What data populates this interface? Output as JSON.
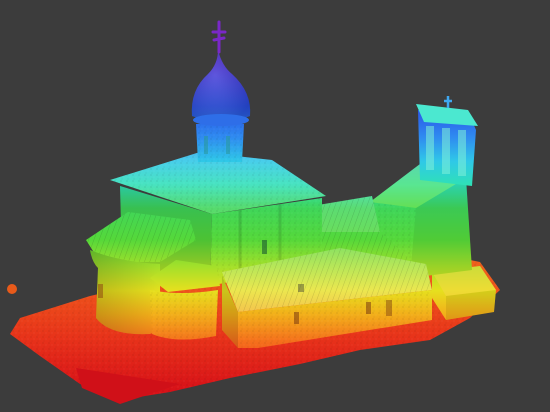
{
  "scene": {
    "subject": "point-cloud-church",
    "background_color": "#3c3c3c",
    "colormap": {
      "type": "elevation",
      "stops": [
        "#e8141a",
        "#f5701c",
        "#f2d21a",
        "#a5e02a",
        "#3fd63a",
        "#2fe0b8",
        "#2fb0f0",
        "#2a4fe8",
        "#6a1fc0"
      ]
    }
  }
}
